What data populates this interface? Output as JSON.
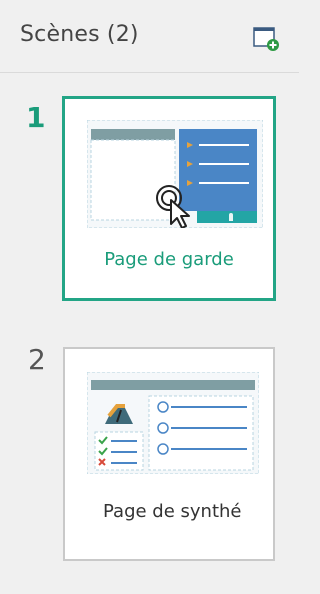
{
  "header": {
    "title": "Scènes (2)",
    "add_scene_icon": "add-scene-icon"
  },
  "scenes": [
    {
      "number": "1",
      "label": "Page de garde",
      "selected": true
    },
    {
      "number": "2",
      "label": "Page de synthé",
      "selected": false
    }
  ],
  "colors": {
    "accent": "#23a586",
    "accent_text": "#1a9c7a",
    "panel_bg": "#f0f0f0",
    "thumb_blue": "#4a86c6",
    "thumb_gray": "#7f9ea3"
  }
}
